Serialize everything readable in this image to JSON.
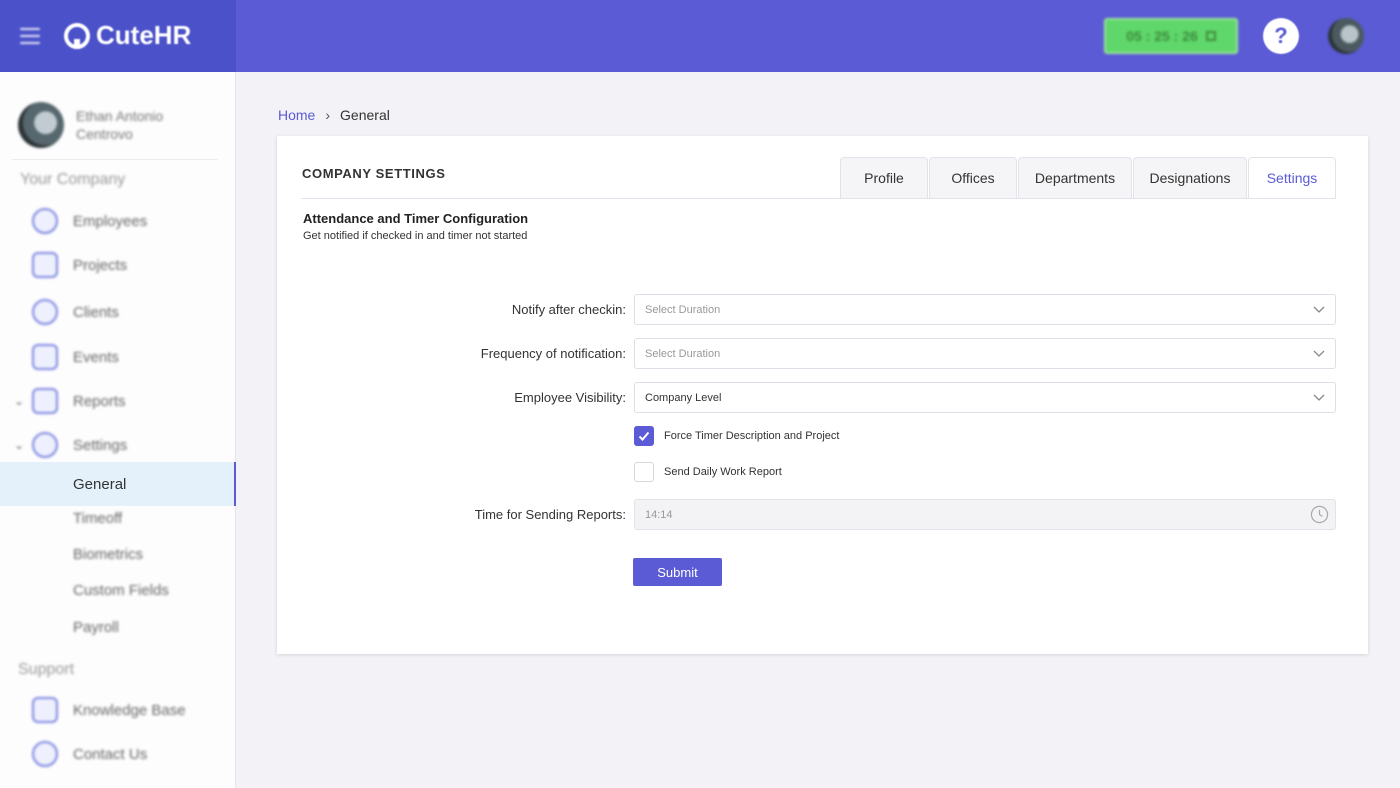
{
  "app": {
    "name": "CuteHR"
  },
  "header": {
    "timer": "05 : 25 : 26",
    "help_label": "?"
  },
  "sidebar": {
    "user_name": "Ethan Antonio Centrovo",
    "section_company": "Your Company",
    "items": [
      {
        "label": "Employees",
        "icon": "employees-icon"
      },
      {
        "label": "Projects",
        "icon": "projects-icon"
      },
      {
        "label": "Clients",
        "icon": "clients-icon"
      },
      {
        "label": "Events",
        "icon": "events-icon"
      },
      {
        "label": "Reports",
        "icon": "reports-icon"
      },
      {
        "label": "Settings",
        "icon": "settings-icon"
      }
    ],
    "settings_sub": [
      "General",
      "Timeoff",
      "Biometrics",
      "Custom Fields",
      "Payroll"
    ],
    "section_support": "Support",
    "support_items": [
      {
        "label": "Knowledge Base",
        "icon": "book-icon"
      },
      {
        "label": "Contact Us",
        "icon": "phone-icon"
      }
    ]
  },
  "breadcrumb": {
    "home": "Home",
    "current": "General"
  },
  "card": {
    "title": "COMPANY SETTINGS",
    "tabs": [
      "Profile",
      "Offices",
      "Departments",
      "Designations",
      "Settings"
    ],
    "active_tab": "Settings",
    "section_title": "Attendance and Timer Configuration",
    "section_desc": "Get notified if checked in and timer not started",
    "fields": {
      "notify_label": "Notify after checkin:",
      "notify_placeholder": "Select Duration",
      "frequency_label": "Frequency of notification:",
      "frequency_placeholder": "Select Duration",
      "visibility_label": "Employee Visibility:",
      "visibility_value": "Company Level",
      "force_timer_label": "Force Timer Description and Project",
      "force_timer_checked": true,
      "daily_report_label": "Send Daily Work Report",
      "daily_report_checked": false,
      "time_label": "Time for Sending Reports:",
      "time_value": "14:14"
    },
    "submit_label": "Submit"
  },
  "colors": {
    "accent": "#5b5bd6",
    "brand_dark": "#4b51c9",
    "timer_green": "#5fd76a",
    "active_bg": "#e4f1fb"
  }
}
